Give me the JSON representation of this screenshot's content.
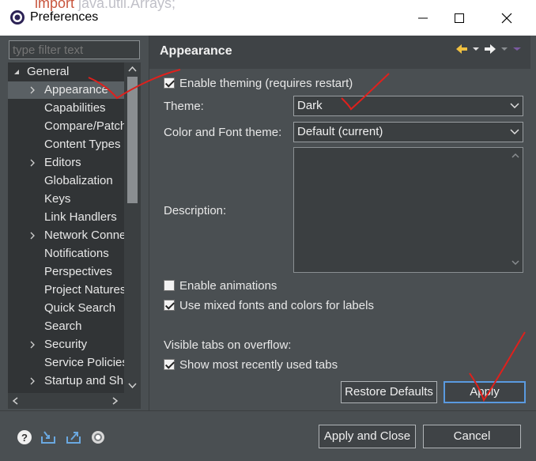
{
  "window": {
    "title": "Preferences",
    "background_text_keyword": "import",
    "background_text_rest": " java.util.Arrays;"
  },
  "filter": {
    "placeholder": "type filter text"
  },
  "tree": {
    "root": "General",
    "items": [
      {
        "label": "Appearance",
        "expandable": true,
        "selected": true
      },
      {
        "label": "Capabilities",
        "expandable": false
      },
      {
        "label": "Compare/Patch",
        "expandable": false
      },
      {
        "label": "Content Types",
        "expandable": false
      },
      {
        "label": "Editors",
        "expandable": true
      },
      {
        "label": "Globalization",
        "expandable": false
      },
      {
        "label": "Keys",
        "expandable": false
      },
      {
        "label": "Link Handlers",
        "expandable": false
      },
      {
        "label": "Network Connections",
        "expandable": true
      },
      {
        "label": "Notifications",
        "expandable": false
      },
      {
        "label": "Perspectives",
        "expandable": false
      },
      {
        "label": "Project Natures",
        "expandable": false
      },
      {
        "label": "Quick Search",
        "expandable": false
      },
      {
        "label": "Search",
        "expandable": false
      },
      {
        "label": "Security",
        "expandable": true
      },
      {
        "label": "Service Policies",
        "expandable": false
      },
      {
        "label": "Startup and Shutdown",
        "expandable": true
      }
    ]
  },
  "page": {
    "title": "Appearance",
    "enable_theming": "Enable theming (requires restart)",
    "theme_label": "Theme:",
    "theme_value": "Dark",
    "color_font_label": "Color and Font theme:",
    "color_font_value": "Default (current)",
    "description_label": "Description:",
    "enable_animations": "Enable animations",
    "mixed_fonts": "Use mixed fonts and colors for labels",
    "visible_tabs_label": "Visible tabs on overflow:",
    "show_recent_tabs": "Show most recently used tabs",
    "restore_defaults": "Restore Defaults",
    "apply": "Apply"
  },
  "checks": {
    "enable_theming": true,
    "enable_animations": false,
    "mixed_fonts": true,
    "show_recent_tabs": true
  },
  "footer": {
    "apply_and_close": "Apply and Close",
    "cancel": "Cancel"
  },
  "icons": [
    "help-icon",
    "import-icon",
    "export-icon",
    "oomph-icon",
    "back-arrow-icon",
    "forward-arrow-icon"
  ],
  "colors": {
    "background": "#4a4f52",
    "tree_background": "#313436",
    "annotation": "#e0201c"
  }
}
